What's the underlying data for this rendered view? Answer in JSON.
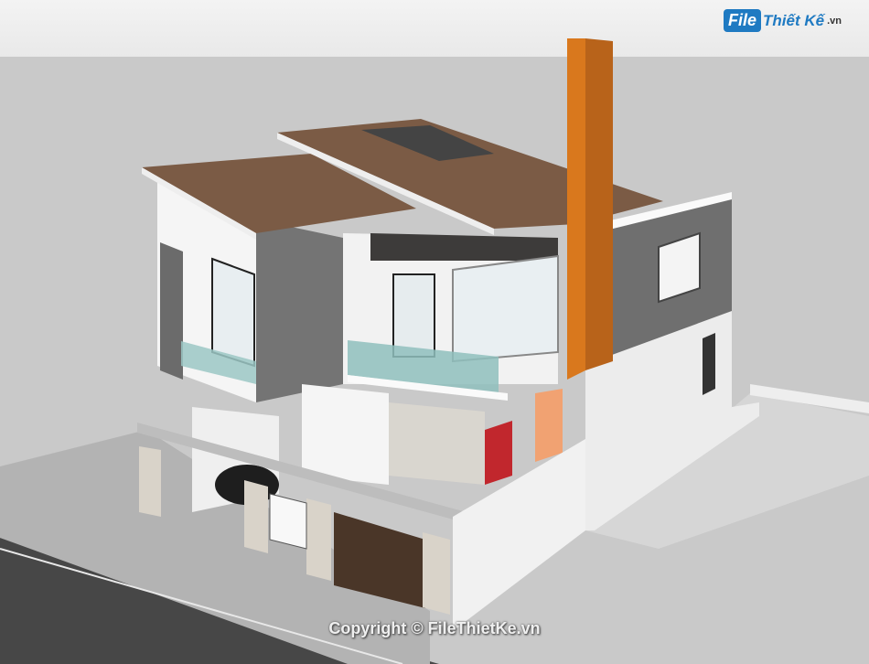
{
  "logo": {
    "brand_prefix": "File",
    "brand_name": "Thiết Kế",
    "brand_tld": ".vn"
  },
  "watermark": {
    "copyright": "Copyright © FileThietKe.vn"
  },
  "colors": {
    "roof": "#7a5a44",
    "wall_white": "#f4f4f4",
    "wall_gray": "#6e6e6e",
    "chimney_orange": "#d97a1f",
    "ground": "#c9c9c9",
    "road": "#4a4a4a"
  }
}
